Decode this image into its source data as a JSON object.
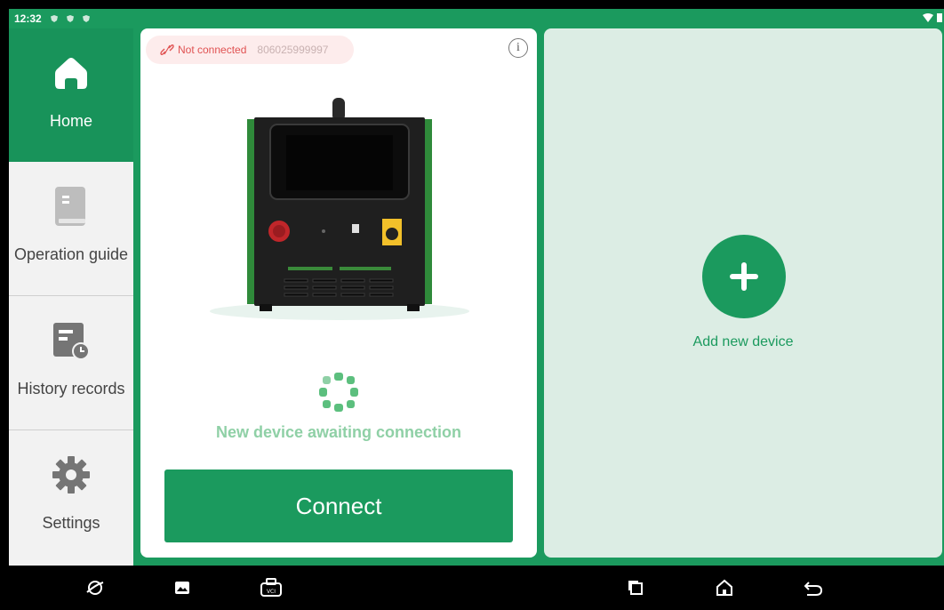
{
  "status_bar": {
    "time": "12:32"
  },
  "sidebar": {
    "items": [
      {
        "label": "Home",
        "icon": "home-icon",
        "active": true
      },
      {
        "label": "Operation guide",
        "icon": "book-icon",
        "active": false
      },
      {
        "label": "History records",
        "icon": "history-records-icon",
        "active": false
      },
      {
        "label": "Settings",
        "icon": "gear-icon",
        "active": false
      }
    ]
  },
  "device_card": {
    "status": "Not connected",
    "serial": "806025999997",
    "await_text": "New device awaiting connection",
    "connect_label": "Connect"
  },
  "add_panel": {
    "label": "Add new device"
  },
  "colors": {
    "brand_green": "#1b9a5e",
    "sidebar_bg": "#f2f2f2",
    "status_red": "#e05252",
    "panel_light": "#dcede4"
  }
}
